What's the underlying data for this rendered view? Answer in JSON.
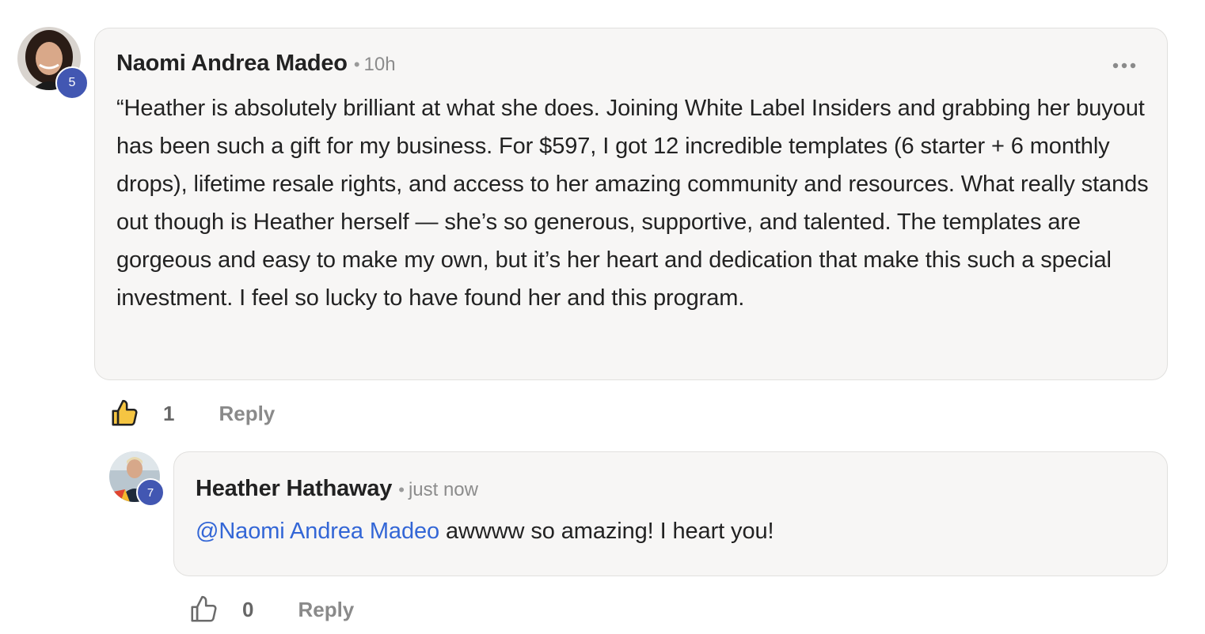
{
  "comment": {
    "author": "Naomi Andrea Madeo",
    "time": "10h",
    "level": "5",
    "text": "“Heather is absolutely brilliant at what she does. Joining White Label Insiders and grabbing her buyout has been such a gift for my business. For $597, I got 12 incredible templates (6 starter + 6 monthly drops), lifetime resale rights, and access to her amazing community and resources. What really stands out though is Heather herself — she’s so generous, supportive, and talented. The templates are gorgeous and easy to make my own, but it’s her heart and dedication that make this such a special investment. I feel so lucky to have found her and this program.",
    "like_count": "1",
    "reply_label": "Reply",
    "liked": true
  },
  "reply": {
    "author": "Heather Hathaway",
    "time": "just now",
    "level": "7",
    "mention": "@Naomi Andrea Madeo",
    "text": " awwww so amazing! I heart you!",
    "like_count": "0",
    "reply_label": "Reply",
    "liked": false
  },
  "separator": "•",
  "icons": {
    "more": "more-horizontal-icon",
    "like": "thumbs-up-icon"
  },
  "colors": {
    "mention": "#3366d6",
    "badge": "#4257b2",
    "bubble_bg": "#f7f6f5",
    "liked_thumb": "#f5c542"
  }
}
